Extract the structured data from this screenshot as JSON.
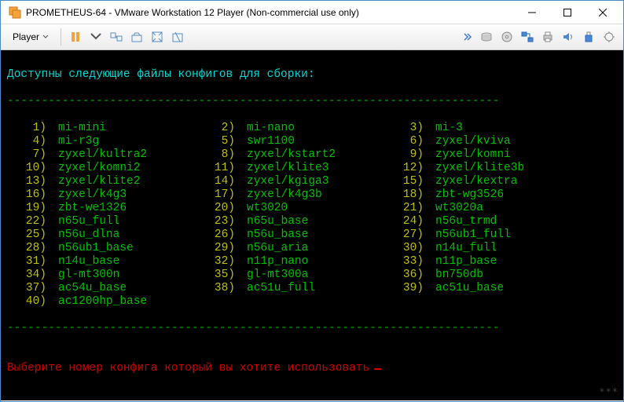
{
  "window": {
    "title": "PROMETHEUS-64 - VMware Workstation 12 Player (Non-commercial use only)"
  },
  "toolbar": {
    "player_label": "Player"
  },
  "terminal": {
    "header": "Доступны следующие файлы конфигов для сборки:",
    "dashes": "------------------------------------------------------------------------",
    "prompt": "Выберите номер конфига который вы хотите использовать",
    "watermark": "***",
    "configs": [
      {
        "n": "1",
        "name": "mi-mini"
      },
      {
        "n": "2",
        "name": "mi-nano"
      },
      {
        "n": "3",
        "name": "mi-3"
      },
      {
        "n": "4",
        "name": "mi-r3g"
      },
      {
        "n": "5",
        "name": "swr1100"
      },
      {
        "n": "6",
        "name": "zyxel/kviva"
      },
      {
        "n": "7",
        "name": "zyxel/kultra2"
      },
      {
        "n": "8",
        "name": "zyxel/kstart2"
      },
      {
        "n": "9",
        "name": "zyxel/komni"
      },
      {
        "n": "10",
        "name": "zyxel/komni2"
      },
      {
        "n": "11",
        "name": "zyxel/klite3"
      },
      {
        "n": "12",
        "name": "zyxel/klite3b"
      },
      {
        "n": "13",
        "name": "zyxel/klite2"
      },
      {
        "n": "14",
        "name": "zyxel/kgiga3"
      },
      {
        "n": "15",
        "name": "zyxel/kextra"
      },
      {
        "n": "16",
        "name": "zyxel/k4g3"
      },
      {
        "n": "17",
        "name": "zyxel/k4g3b"
      },
      {
        "n": "18",
        "name": "zbt-wg3526"
      },
      {
        "n": "19",
        "name": "zbt-we1326"
      },
      {
        "n": "20",
        "name": "wt3020"
      },
      {
        "n": "21",
        "name": "wt3020a"
      },
      {
        "n": "22",
        "name": "n65u_full"
      },
      {
        "n": "23",
        "name": "n65u_base"
      },
      {
        "n": "24",
        "name": "n56u_trmd"
      },
      {
        "n": "25",
        "name": "n56u_dlna"
      },
      {
        "n": "26",
        "name": "n56u_base"
      },
      {
        "n": "27",
        "name": "n56ub1_full"
      },
      {
        "n": "28",
        "name": "n56ub1_base"
      },
      {
        "n": "29",
        "name": "n56u_aria"
      },
      {
        "n": "30",
        "name": "n14u_full"
      },
      {
        "n": "31",
        "name": "n14u_base"
      },
      {
        "n": "32",
        "name": "n11p_nano"
      },
      {
        "n": "33",
        "name": "n11p_base"
      },
      {
        "n": "34",
        "name": "gl-mt300n"
      },
      {
        "n": "35",
        "name": "gl-mt300a"
      },
      {
        "n": "36",
        "name": "bn750db"
      },
      {
        "n": "37",
        "name": "ac54u_base"
      },
      {
        "n": "38",
        "name": "ac51u_full"
      },
      {
        "n": "39",
        "name": "ac51u_base"
      },
      {
        "n": "40",
        "name": "ac1200hp_base"
      }
    ]
  }
}
